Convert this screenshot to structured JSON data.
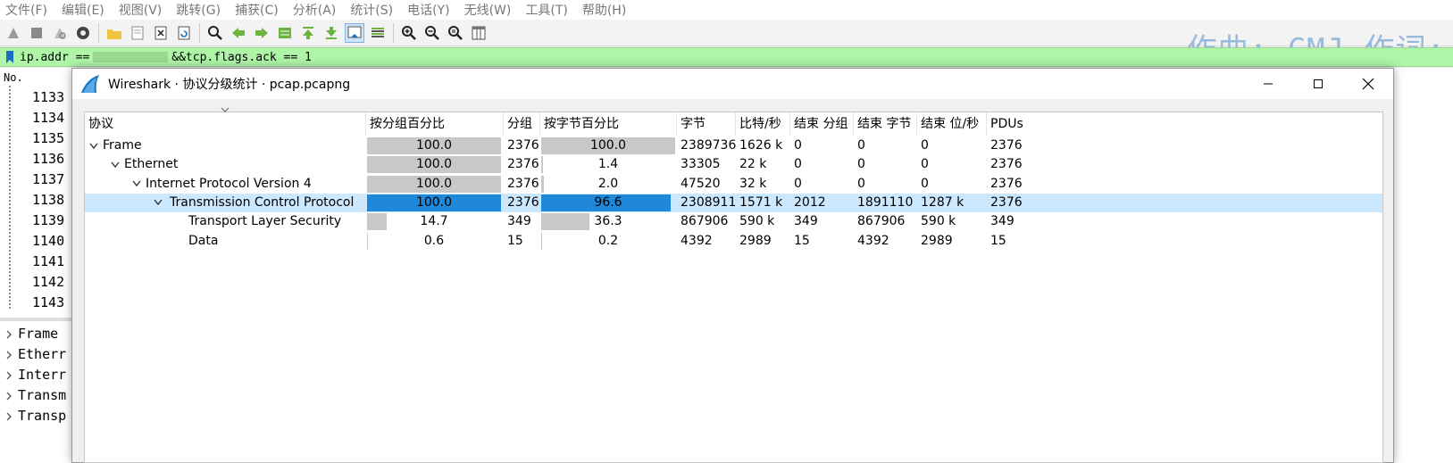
{
  "menubar": [
    "文件(F)",
    "编辑(E)",
    "视图(V)",
    "跳转(G)",
    "捕获(C)",
    "分析(A)",
    "统计(S)",
    "电话(Y)",
    "无线(W)",
    "工具(T)",
    "帮助(H)"
  ],
  "watermark": "作曲: CMJ 作词:",
  "filter": {
    "prefix": "ip.addr ==",
    "suffix": "&&tcp.flags.ack == 1"
  },
  "packet_list": {
    "header": "No.",
    "rows": [
      "1133",
      "1134",
      "1135",
      "1136",
      "1137",
      "1138",
      "1139",
      "1140",
      "1141",
      "1142",
      "1143"
    ]
  },
  "details": [
    "Frame",
    "Etherr",
    "Interr",
    "Transm",
    "Transp"
  ],
  "dialog": {
    "title": "Wireshark · 协议分级统计 · pcap.pcapng",
    "columns": [
      "协议",
      "按分组百分比",
      "分组",
      "按字节百分比",
      "字节",
      "比特/秒",
      "结束 分组",
      "结束 字节",
      "结束 位/秒",
      "PDUs"
    ],
    "rows": [
      {
        "protocol": "Frame",
        "pct_packets": "100.0",
        "pct_packets_fill": 100.0,
        "packets": "2376",
        "pct_bytes": "100.0",
        "pct_bytes_fill": 100.0,
        "bytes": "2389736",
        "bits_s": "1626 k",
        "end_packets": "0",
        "end_bytes": "0",
        "end_bits_s": "0",
        "pdus": "2376"
      },
      {
        "protocol": "Ethernet",
        "pct_packets": "100.0",
        "pct_packets_fill": 100.0,
        "packets": "2376",
        "pct_bytes": "1.4",
        "pct_bytes_fill": 1.4,
        "bytes": "33305",
        "bits_s": "22 k",
        "end_packets": "0",
        "end_bytes": "0",
        "end_bits_s": "0",
        "pdus": "2376"
      },
      {
        "protocol": "Internet Protocol Version 4",
        "pct_packets": "100.0",
        "pct_packets_fill": 100.0,
        "packets": "2376",
        "pct_bytes": "2.0",
        "pct_bytes_fill": 2.0,
        "bytes": "47520",
        "bits_s": "32 k",
        "end_packets": "0",
        "end_bytes": "0",
        "end_bits_s": "0",
        "pdus": "2376"
      },
      {
        "protocol": "Transmission Control Protocol",
        "pct_packets": "100.0",
        "pct_packets_fill": 100.0,
        "packets": "2376",
        "pct_bytes": "96.6",
        "pct_bytes_fill": 96.6,
        "bytes": "2308911",
        "bits_s": "1571 k",
        "end_packets": "2012",
        "end_bytes": "1891110",
        "end_bits_s": "1287 k",
        "pdus": "2376"
      },
      {
        "protocol": "Transport Layer Security",
        "pct_packets": "14.7",
        "pct_packets_fill": 14.7,
        "packets": "349",
        "pct_bytes": "36.3",
        "pct_bytes_fill": 36.3,
        "bytes": "867906",
        "bits_s": "590 k",
        "end_packets": "349",
        "end_bytes": "867906",
        "end_bits_s": "590 k",
        "pdus": "349"
      },
      {
        "protocol": "Data",
        "pct_packets": "0.6",
        "pct_packets_fill": 0.6,
        "packets": "15",
        "pct_bytes": "0.2",
        "pct_bytes_fill": 0.2,
        "bytes": "4392",
        "bits_s": "2989",
        "end_packets": "15",
        "end_bytes": "4392",
        "end_bits_s": "2989",
        "pdus": "15"
      }
    ]
  },
  "colors": {
    "selection": "#cce8ff",
    "bar_selected": "#1f88d9",
    "bar": "#c8c8c8",
    "filter_ok": "#aff5a8"
  }
}
